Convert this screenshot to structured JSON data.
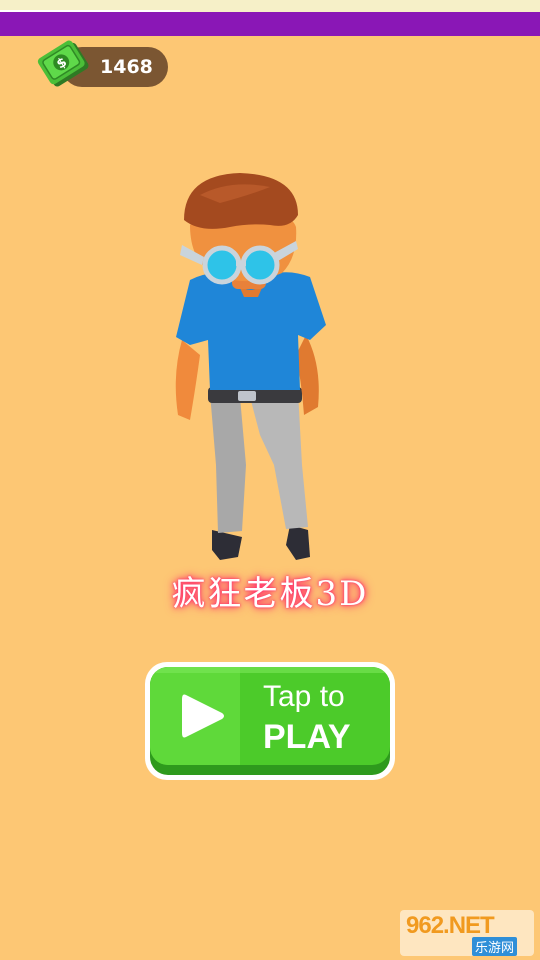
{
  "hud": {
    "cash_icon": "cash-banknote-icon",
    "cash_amount": "1468"
  },
  "title": {
    "text": "疯狂老板3D"
  },
  "play_button": {
    "icon": "play-triangle-icon",
    "line1": "Tap to",
    "line2": "PLAY"
  },
  "watermark": {
    "main": "962.NET",
    "sub": "乐游网"
  },
  "colors": {
    "background": "#fdc774",
    "top_bar": "#8a17b6",
    "button_green": "#4ccb2a",
    "cash_pill": "#7b5632",
    "title_glow": "#ff2e6a"
  }
}
